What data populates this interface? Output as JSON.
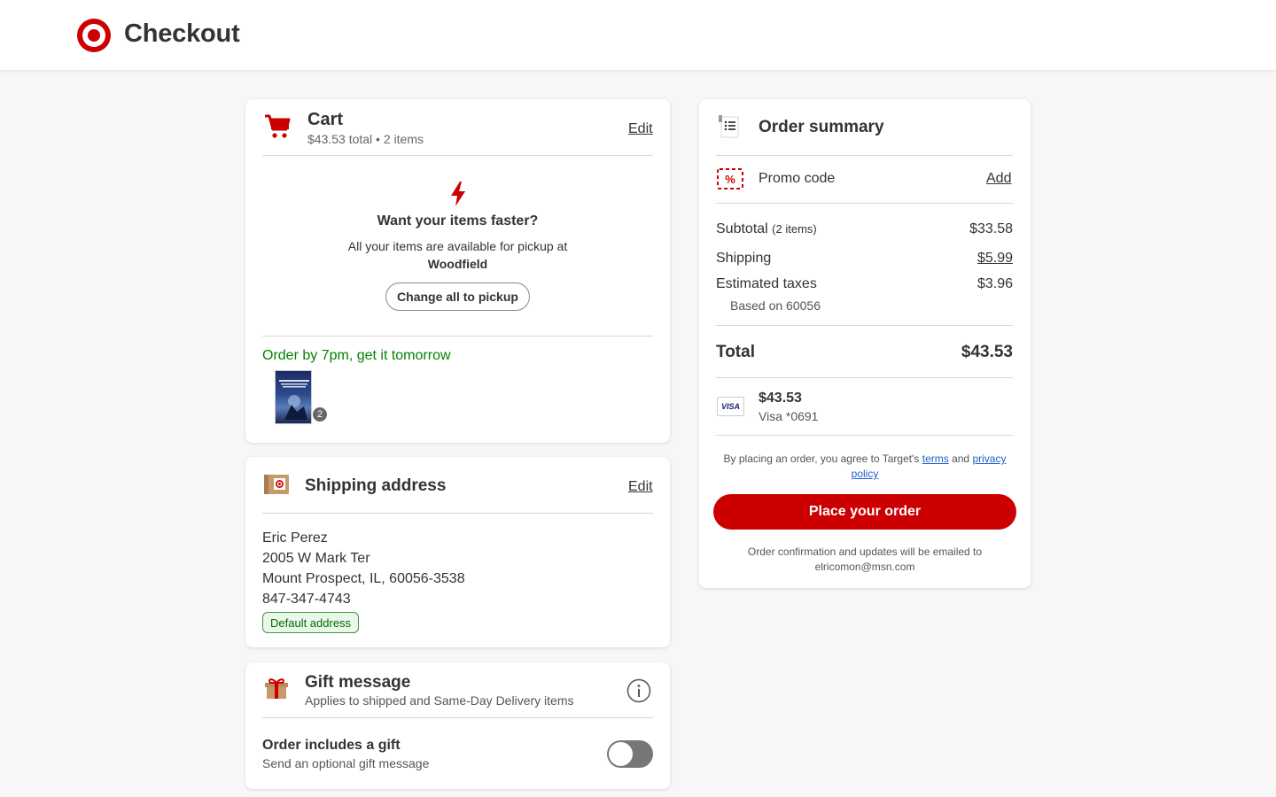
{
  "header": {
    "title": "Checkout",
    "logo_icon": "target-bullseye-icon",
    "brand_color": "#cc0000"
  },
  "cart": {
    "title": "Cart",
    "subtitle": "$43.53 total • 2 items",
    "edit_label": "Edit",
    "faster_title": "Want your items faster?",
    "faster_text": "All your items are available for pickup at",
    "faster_store": "Woodfield",
    "pickup_button": "Change all to pickup",
    "order_by": "Order by 7pm, get it tomorrow",
    "item_quantity": "2"
  },
  "shipping": {
    "title": "Shipping address",
    "edit_label": "Edit",
    "name": "Eric Perez",
    "street": "2005 W Mark Ter",
    "city_line": "Mount Prospect, IL, 60056-3538",
    "phone": "847-347-4743",
    "badge": "Default address"
  },
  "gift": {
    "title": "Gift message",
    "subtitle": "Applies to shipped and Same-Day Delivery items",
    "toggle_title": "Order includes a gift",
    "toggle_subtitle": "Send an optional gift message",
    "toggle_on": false
  },
  "summary": {
    "title": "Order summary",
    "promo_label": "Promo code",
    "promo_action": "Add",
    "subtotal_label": "Subtotal",
    "subtotal_count": "(2 items)",
    "subtotal_value": "$33.58",
    "shipping_label": "Shipping",
    "shipping_value": "$5.99",
    "taxes_label": "Estimated taxes",
    "taxes_value": "$3.96",
    "taxes_note": "Based on 60056",
    "total_label": "Total",
    "total_value": "$43.53",
    "payment_brand": "VISA",
    "payment_amount": "$43.53",
    "payment_card": "Visa *0691",
    "legal_prefix": "By placing an order, you agree to Target's",
    "legal_terms": "terms",
    "legal_and": "and",
    "legal_privacy": "privacy policy",
    "place_order": "Place your order",
    "confirm_note": "Order confirmation and updates will be emailed to",
    "email": "elricomon@msn.com"
  }
}
